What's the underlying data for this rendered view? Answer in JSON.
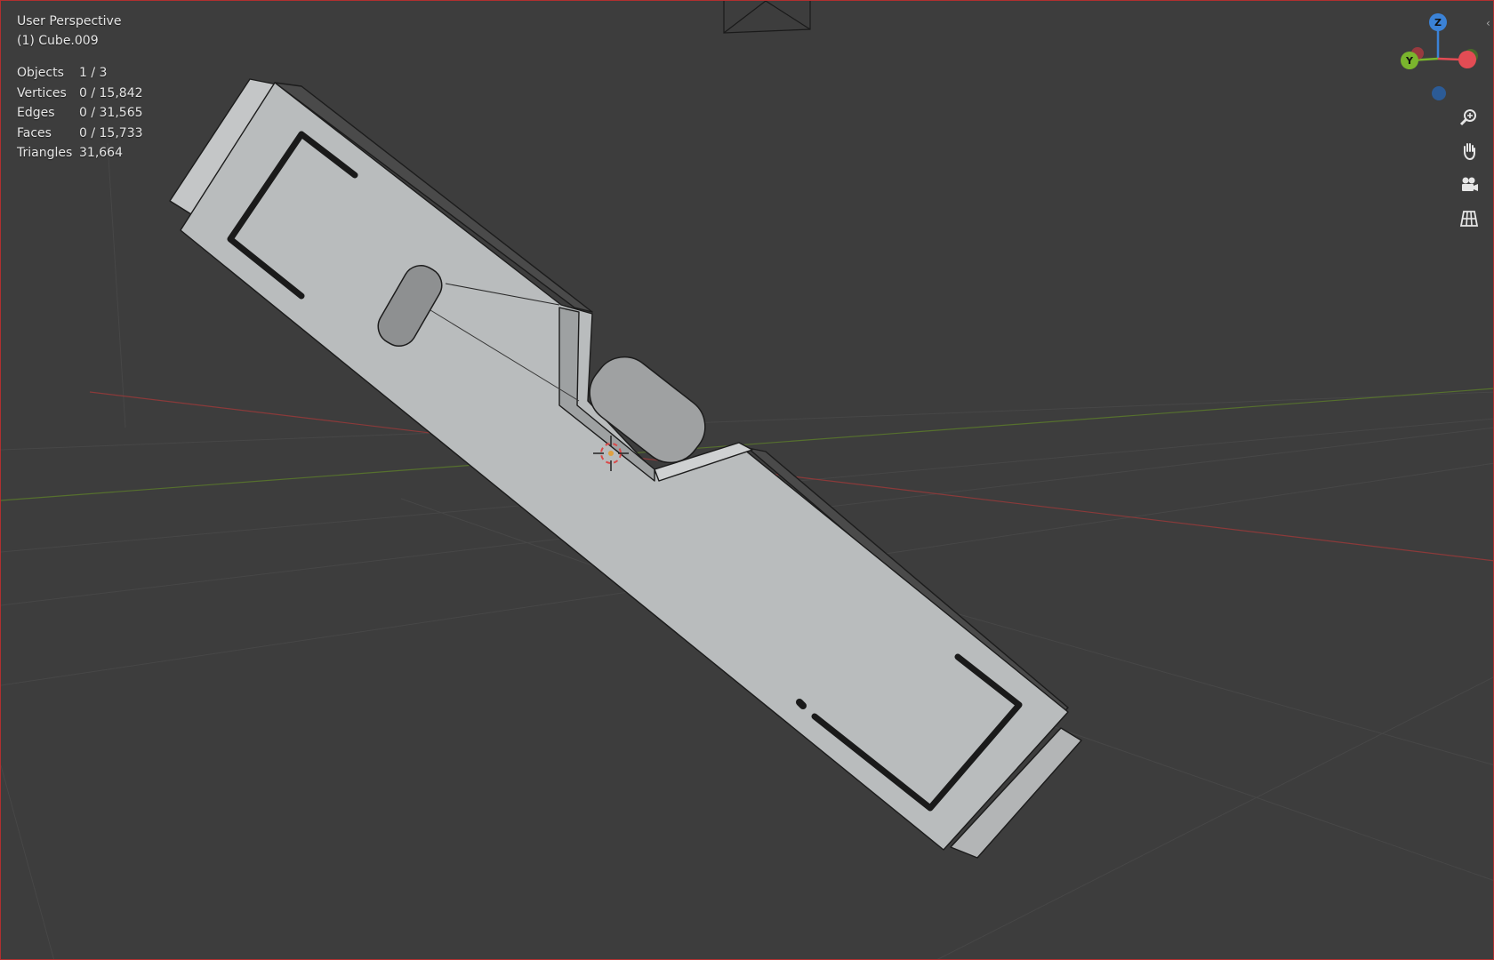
{
  "viewport": {
    "view_name": "User Perspective",
    "object_name": "(1) Cube.009"
  },
  "stats": [
    {
      "label": "Objects",
      "value": "1 / 3"
    },
    {
      "label": "Vertices",
      "value": "0 / 15,842"
    },
    {
      "label": "Edges",
      "value": "0 / 31,565"
    },
    {
      "label": "Faces",
      "value": "0 / 15,733"
    },
    {
      "label": "Triangles",
      "value": "31,664"
    }
  ],
  "gizmo": {
    "z_label": "Z",
    "y_label": "Y",
    "colors": {
      "x": "#e34c54",
      "y": "#7ab52d",
      "z": "#3b82d6"
    }
  },
  "tools": [
    {
      "icon": "zoom-icon"
    },
    {
      "icon": "pan-hand-icon"
    },
    {
      "icon": "camera-icon"
    },
    {
      "icon": "grid-ortho-icon"
    }
  ],
  "colors": {
    "background": "#3d3d3d",
    "object_fill": "#b9bcbd",
    "grid": "#474747"
  }
}
